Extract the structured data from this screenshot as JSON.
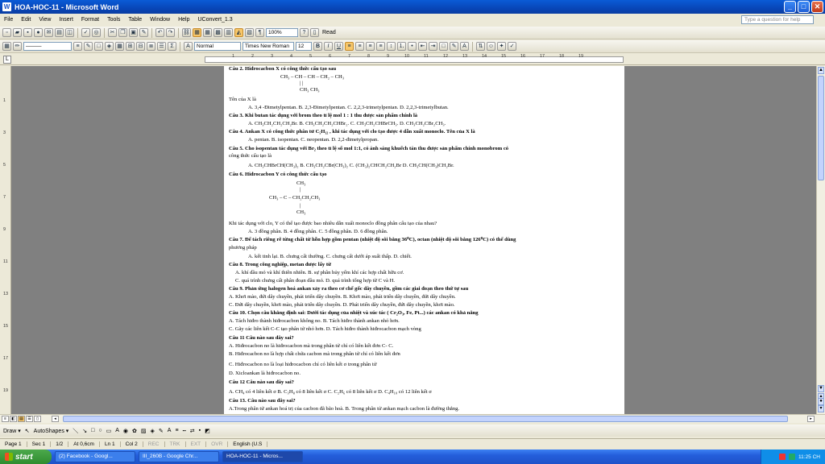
{
  "window": {
    "title": "HOA-HOC-11 - Microsoft Word",
    "minimize": "_",
    "maximize": "□",
    "close": "✕"
  },
  "menu": [
    "File",
    "Edit",
    "View",
    "Insert",
    "Format",
    "Tools",
    "Table",
    "Window",
    "Help",
    "UConvert_1.3"
  ],
  "help_placeholder": "Type a question for help",
  "toolbar": {
    "zoom": "100%",
    "read": "Read",
    "style": "Normal",
    "font": "Times New Roman",
    "size": "12",
    "bold": "B",
    "italic": "I",
    "underline": "U"
  },
  "ruler_numbers": [
    "1",
    "2",
    "3",
    "4",
    "5",
    "6",
    "7",
    "8",
    "9",
    "10",
    "11",
    "12",
    "13",
    "14",
    "15",
    "16",
    "17",
    "18",
    "19"
  ],
  "document": {
    "lines": [
      "Câu 2. Hiđrocacbon X có công thức cấu tạo sau",
      "CH₃ – CH – CH – CH₂ – CH₃",
      "|        |",
      "CH₃  CH₃",
      "Tên của X là",
      "A. 3,4 -Đimetylpentan.        B. 2,3-Đimetylpentan.        C. 2,2,3-trimetylpentan.        D. 2,2,3-trimetylbutan.",
      "Câu 3. Khi butan tác dụng với brom theo tỉ lệ mol 1 : 1 thu được sản phẩm chính là",
      "A. CH₃CH₂CH₂CH₂Br.     B. CH₃CH₂CH₂CHBr₂.     C. CH₃CH₂CHBrCH₃.     D. CH₃CH₂CBr₂CH₃.",
      "Câu 4. Ankan X có công thức phân tử C₅H₁₂ , khi tác dụng với clo tạo được 4 dẫn xuất monoclo. Tên của X là",
      "A. pentan.                    B. isopentan.                    C. neopentan.                    D. 2,2-đimetylpropan.",
      "Câu 5. Cho isopentan tác dụng với Br₂ theo tỉ lệ số mol 1:1, có ánh sáng khuếch tán thu được sản phẩm chính monobrom có",
      "công thức cấu tạo là",
      "A. CH₃CHBrCH(CH₃)₂        B. CH₃CH₂CBr(CH₃)₂        C. (CH₃)₂CHCH₂CH₂Br        D. CH₃CH(CH₃)CH₂Br.",
      "Câu 6. Hiđrocacbon Y có công thức cấu tạo",
      "CH₃",
      "|",
      "CH₃ – C – CH₂CH₂CH₃",
      "|",
      "CH₃",
      "Khi tác dụng với clo, Y có thể tạo được bao nhiêu dẫn xuất monoclo đồng phân cấu tạo của nhau?",
      "A. 3 đồng phân.          B. 4 đồng phân.          C. 5 đồng phân.          D. 6 đồng phân.",
      "Câu 7. Để tách riêng rẽ từng chất từ hỗn hợp gồm pentan (nhiệt độ sôi bằng 36⁰C), octan (nhiệt độ sôi bằng 126⁰C) có thể dùng",
      "phương pháp",
      "A. kết tinh lại.       B. chưng cất thường.  C. chưng cất dưới áp suất thấp.          D. chiết.",
      "Câu 8. Trong công nghiệp, metan được lấy từ",
      "A. khí dầu mỏ và khí thiên nhiên.                         B. sự phân hủy yếm khí các hợp chất hữu cơ.",
      "C. quá trình chưng cất phân đoạn dầu mỏ.                 D. quá trình tổng hợp từ C và H.",
      "Câu 9. Phản ứng halogen hoá ankan xảy ra theo cơ chế gốc dây chuyền, gồm các giai đoạn theo thứ tự sau",
      "A. Khơi mào, đứt dây chuyền, phát triển dây chuyền.       B. Khơi mào, phát triển dây chuyền, đứt dây chuyền.",
      "C. Đứt dây chuyền, khơi mào, phát triển dây chuyền.       D. Phát triển dây chuyền, đứt dây chuyền, khơi mào.",
      "Câu 10. Chọn câu khẳng định sai: Dưới tác dụng của nhiệt và xúc tác ( Cr₂O₃, Fe, Pt...) các ankan có khả năng",
      "A. Tách hiđro thành hiđrocacbon không no.                 B. Tách hiđro thành ankan nhỏ hơn.",
      "C. Gãy các liên kết C-C tạo phân tử nhỏ hơn.             D. Tách hiđro thành hiđrocacbon mạch vòng",
      "Câu 11 Câu nào sau đây sai?",
      "A. Hiđrocacbon no là hiđrocacbon mà trong phân tử chỉ có liên kết đơn C- C.",
      "B. Hiđrocacbon no là hợp chất chứa cacbon mà trong phân tử chỉ có liên kết đơn",
      "C. Hiđrocacbon no là loại hiđrocacbon chỉ có liên kết σ trong phân tử",
      "D. Xicloankan là hiđrocacbon no.",
      "Câu 12 Câu nào sau đây sai?",
      "A. CH₄ có 4 liên kết σ           B. C₃H₈ có 8 liên kết σ  C. C₂H₆ có 8 liên kết σ       D. C₄H₁₀ có 12 liên kết σ",
      "Câu 13. Câu nào sau đây sai?",
      "A.Trong phân tử ankan hoá trị của cacbon đã bão hoà.        B. Trong phân tử ankan mạch cacbon là đường thẳng."
    ]
  },
  "drawbar": {
    "draw": "Draw ▾",
    "autoshapes": "AutoShapes ▾"
  },
  "status": {
    "page": "Page 1",
    "sec": "Sec 1",
    "pages": "1/2",
    "at": "At 0,6cm",
    "ln": "Ln 1",
    "col": "Col 2",
    "rec": "REC",
    "trk": "TRK",
    "ext": "EXT",
    "ovr": "OVR",
    "lang": "English (U.S"
  },
  "taskbar": {
    "start": "start",
    "tasks": [
      "(2) Facebook - Googl...",
      "III_260B - Google Chr...",
      "HOA-HOC-11 - Micros..."
    ],
    "clock": "11:25 CH"
  }
}
